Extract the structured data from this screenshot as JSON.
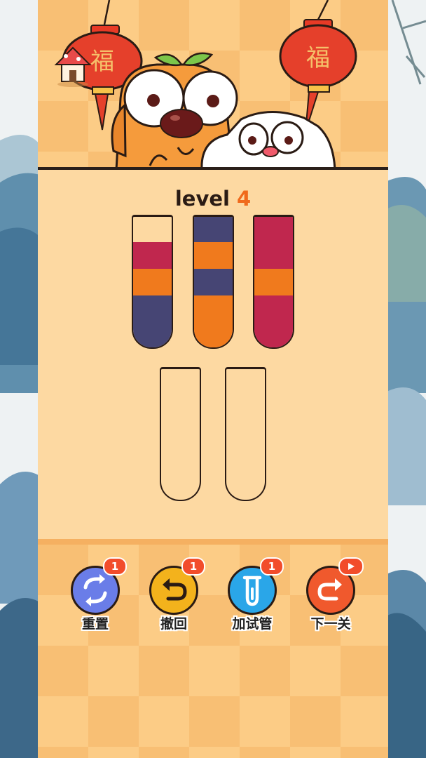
{
  "level": {
    "label": "level",
    "number": "4"
  },
  "lanterns": {
    "left_char": "福",
    "right_char": "福"
  },
  "colors": {
    "red": "#c0274e",
    "orange": "#f07a1d",
    "navy": "#464574"
  },
  "tubes": [
    {
      "layers_top_to_bottom": [
        "red",
        "orange",
        "navy"
      ]
    },
    {
      "layers_top_to_bottom": [
        "navy",
        "orange",
        "navy",
        "orange"
      ]
    },
    {
      "layers_top_to_bottom": [
        "red",
        "red",
        "orange",
        "red"
      ]
    },
    {
      "layers_top_to_bottom": []
    },
    {
      "layers_top_to_bottom": []
    }
  ],
  "buttons": [
    {
      "label": "重置",
      "badge": "1",
      "icon": "reset-icon",
      "color": "#6a7de8"
    },
    {
      "label": "撤回",
      "badge": "1",
      "icon": "undo-icon",
      "color": "#f3b21c"
    },
    {
      "label": "加试管",
      "badge": "1",
      "icon": "add-tube-icon",
      "color": "#2aa6e8"
    },
    {
      "label": "下一关",
      "badge": "",
      "icon": "next-level-icon",
      "color": "#f0592d"
    }
  ]
}
